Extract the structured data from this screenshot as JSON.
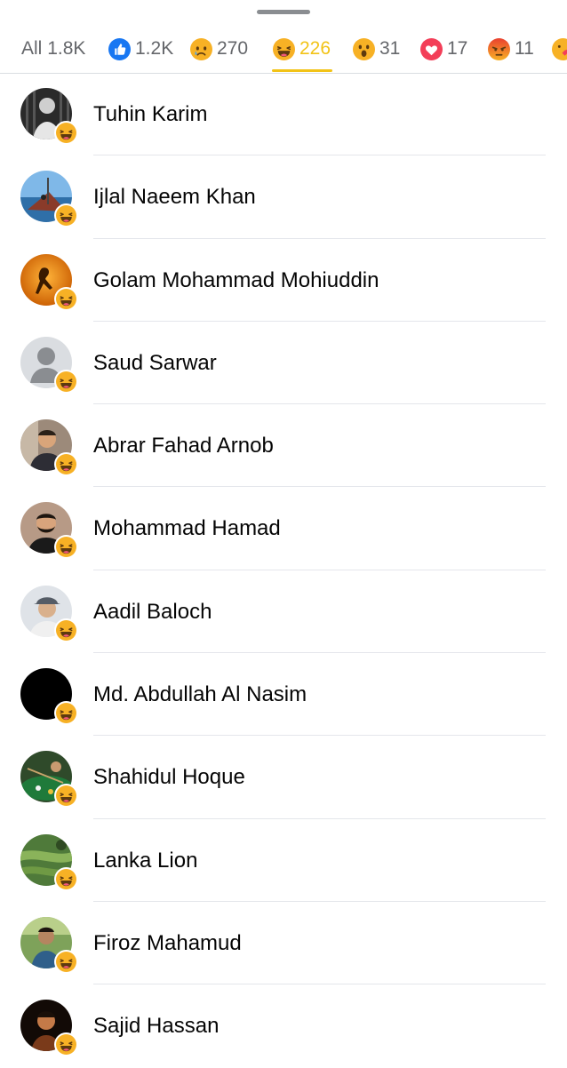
{
  "tabs": [
    {
      "label": "All",
      "count": "1.8K",
      "icon": "none",
      "active": false
    },
    {
      "label": "",
      "count": "1.2K",
      "icon": "like-icon",
      "active": false
    },
    {
      "label": "",
      "count": "270",
      "icon": "sad-emoji-icon",
      "active": false
    },
    {
      "label": "",
      "count": "226",
      "icon": "haha-emoji-icon",
      "active": true
    },
    {
      "label": "",
      "count": "31",
      "icon": "wow-emoji-icon",
      "active": false
    },
    {
      "label": "",
      "count": "17",
      "icon": "love-heart-icon",
      "active": false
    },
    {
      "label": "",
      "count": "11",
      "icon": "angry-emoji-icon",
      "active": false
    },
    {
      "label": "",
      "count": "",
      "icon": "care-emoji-icon",
      "active": false
    }
  ],
  "colors": {
    "active": "#f2c317",
    "inactive": "#65676b",
    "like": "#1877f2",
    "love": "#f33e58",
    "angry": "#e9710f",
    "emoji_yellow": "#f7b125"
  },
  "people": [
    {
      "name": "Tuhin Karim",
      "avatar": "bw-photo",
      "reaction": "haha-emoji-icon"
    },
    {
      "name": "Ijlal Naeem Khan",
      "avatar": "boat-photo",
      "reaction": "haha-emoji-icon"
    },
    {
      "name": "Golam Mohammad Mohiuddin",
      "avatar": "orange-silhouette",
      "reaction": "haha-emoji-icon"
    },
    {
      "name": "Saud Sarwar",
      "avatar": "default-avatar",
      "reaction": "haha-emoji-icon"
    },
    {
      "name": "Abrar Fahad Arnob",
      "avatar": "man-photo",
      "reaction": "haha-emoji-icon"
    },
    {
      "name": "Mohammad Hamad",
      "avatar": "bearded-man-photo",
      "reaction": "haha-emoji-icon"
    },
    {
      "name": "Aadil Baloch",
      "avatar": "cap-man-photo",
      "reaction": "haha-emoji-icon"
    },
    {
      "name": "Md. Abdullah Al Nasim",
      "avatar": "black-avatar",
      "reaction": "haha-emoji-icon"
    },
    {
      "name": "Shahidul Hoque",
      "avatar": "billiards-photo",
      "reaction": "haha-emoji-icon"
    },
    {
      "name": "Lanka Lion",
      "avatar": "green-field-photo",
      "reaction": "haha-emoji-icon"
    },
    {
      "name": "Firoz Mahamud",
      "avatar": "outdoor-man-photo",
      "reaction": "haha-emoji-icon"
    },
    {
      "name": "Sajid Hassan",
      "avatar": "dark-portrait-photo",
      "reaction": "haha-emoji-icon"
    }
  ]
}
